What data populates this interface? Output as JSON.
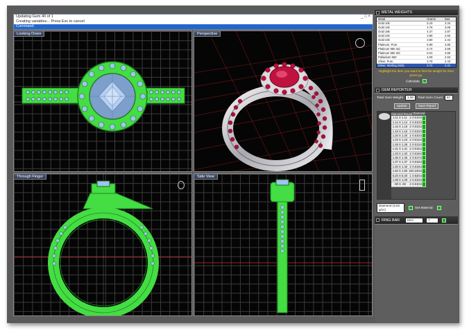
{
  "command": {
    "line1": "Updating Gem 40 of 1",
    "line2": "Creating variables... Press Esc to cancel",
    "prompt": "Command:",
    "window_buttons": "_ □ ×"
  },
  "viewports": [
    {
      "id": "top",
      "title": "Looking Down"
    },
    {
      "id": "persp",
      "title": "Perspective"
    },
    {
      "id": "front",
      "title": "Through Finger"
    },
    {
      "id": "side",
      "title": "Side View"
    }
  ],
  "panel": {
    "metal_weights": {
      "title": "METAL WEIGHTS",
      "columns": [
        "Metal",
        "Grams",
        "Dwt"
      ],
      "rows": [
        [
          "Gold 10k",
          "5.19",
          "3.34"
        ],
        [
          "Gold 14k",
          "4.76",
          "3.06"
        ],
        [
          "Gold 18k",
          "4.47",
          "2.87"
        ],
        [
          "Gold 22k",
          "3.88",
          "2.50"
        ],
        [
          "Gold 24k",
          "3.80",
          "2.44"
        ],
        [
          "Platinum, Pure",
          "5.99",
          "3.85"
        ],
        [
          "Platinum 950 Ind",
          "5.74",
          "3.69"
        ],
        [
          "Platinum 950 Irid",
          "6.01",
          "3.86"
        ],
        [
          "Palladium 950",
          "4.09",
          "2.63"
        ],
        [
          "Silver, Pure",
          "3.78",
          "2.43"
        ],
        [
          "Silver, Sterling (925)",
          "3.74",
          "2.41"
        ]
      ],
      "selected_row": 10,
      "note": "Highlight the item you want to find the weight for then press go.",
      "calculate_label": "Calculate"
    },
    "gem_reporter": {
      "title": "GEM REPORTER",
      "total_weight_label": "Total Gem Weight",
      "total_weight_value": "1.06",
      "total_count_label": "Total Gem Count",
      "total_count_value": "67",
      "update_label": "Update",
      "save_report_label": "Save Report",
      "columns": [
        "Diamond Round",
        "Diamond"
      ],
      "rows": [
        [
          "1.11 X 1.11",
          "2",
          "0.010ct"
        ],
        [
          "1.14 X 1.14",
          "2",
          "0.010ct"
        ],
        [
          "1.16 X 1.16",
          "2",
          "0.010ct"
        ],
        [
          "1.18 X 1.18",
          "2",
          "0.010ct"
        ],
        [
          "1.20 X 1.20",
          "2",
          "0.010ct"
        ],
        [
          "1.23 X 1.23",
          "2",
          "0.012ct"
        ],
        [
          "1.28 X 1.28",
          "2",
          "0.013ct"
        ],
        [
          "1.31 X 1.31",
          "2",
          "0.015ct"
        ],
        [
          "1.33 X 1.33",
          "2",
          "0.016ct"
        ],
        [
          "1.35 X 1.35",
          "2",
          "0.017ct"
        ],
        [
          "1.37 X 1.37",
          "2",
          "0.018ct"
        ],
        [
          "1.40 X 1.40",
          "2",
          "0.019ct"
        ],
        [
          "1.50 X 1.50",
          "18",
          "0.240ct"
        ],
        [
          "5.20 X 5.20",
          "1",
          "0.520ct"
        ],
        [
          "1.09 X 1.09",
          "2",
          "0.010ct"
        ],
        [
          "-90 X .90",
          "4",
          "0.010ct"
        ]
      ],
      "material_select": "Diamond (3.52 g/cc)",
      "set_material_label": "Set Material"
    },
    "ring_bar": {
      "title": "RING BAR",
      "region_select": "USA",
      "size_value": "7"
    }
  },
  "colors": {
    "wire_green": "#44dd44",
    "gem_blue": "#8fb0e0",
    "ruby": "#b8103a",
    "metal": "#c8c8cc",
    "panel_bg": "#5e5e5e",
    "accent_yellow": "#ffd21e"
  }
}
